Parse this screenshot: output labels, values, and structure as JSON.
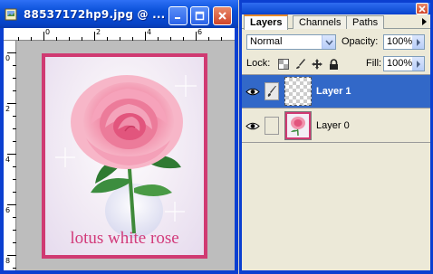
{
  "document_window": {
    "title": "88537172hp9.jpg @ ...",
    "app_icon": "photoshop-document-icon",
    "buttons": [
      "minimize",
      "maximize",
      "close"
    ],
    "ruler_top_numbers": [
      "0",
      "2",
      "4",
      "6"
    ],
    "ruler_left_numbers": [
      "0",
      "2",
      "4",
      "6",
      "8"
    ],
    "image_caption": "lotus white rose"
  },
  "layers_panel": {
    "tabs": [
      {
        "label": "Layers",
        "active": true
      },
      {
        "label": "Channels",
        "active": false
      },
      {
        "label": "Paths",
        "active": false
      }
    ],
    "blend_mode": "Normal",
    "opacity_label": "Opacity:",
    "opacity_value": "100%",
    "lock_label": "Lock:",
    "fill_label": "Fill:",
    "fill_value": "100%",
    "lock_icons": [
      "lock-transparent-icon",
      "lock-brush-icon",
      "lock-move-icon",
      "lock-all-icon"
    ],
    "layers": [
      {
        "name": "Layer 1",
        "selected": true,
        "visible": true,
        "linked_icon": "brush-icon",
        "thumb": "transparent"
      },
      {
        "name": "Layer 0",
        "selected": false,
        "visible": true,
        "linked_icon": "",
        "thumb": "rose"
      }
    ]
  },
  "colors": {
    "titlebar_blue": "#0a50d8",
    "frame_pink": "#d03a72",
    "caption_pink": "#d23a7a",
    "selection_blue": "#3268c8",
    "panel_bg": "#ece9d8"
  }
}
